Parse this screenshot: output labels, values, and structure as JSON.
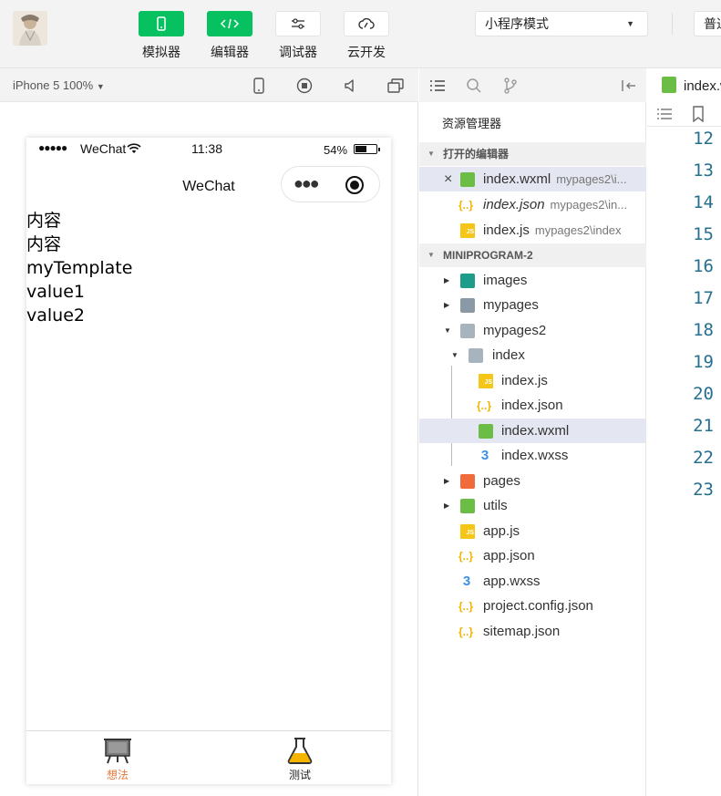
{
  "toolbar": {
    "buttons": [
      {
        "label": "模拟器",
        "icon": "phone-icon",
        "active": true
      },
      {
        "label": "编辑器",
        "icon": "code-icon",
        "active": true
      },
      {
        "label": "调试器",
        "icon": "debug-icon",
        "active": false
      },
      {
        "label": "云开发",
        "icon": "cloud-icon",
        "active": false
      }
    ],
    "mode_select": "小程序模式",
    "compile_select": "普通编译"
  },
  "simulator": {
    "device": "iPhone 5 100%",
    "status": {
      "carrier": "WeChat",
      "time": "11:38",
      "battery": "54%",
      "battery_level": 0.54
    },
    "nav_title": "WeChat",
    "content_lines": [
      "内容",
      "内容",
      "myTemplate",
      "value1",
      "value2"
    ],
    "tabs": [
      {
        "label": "想法",
        "icon": "easel-icon",
        "active": true,
        "color": "#e8793e"
      },
      {
        "label": "测试",
        "icon": "flask-icon",
        "active": false,
        "color": "#222222"
      }
    ]
  },
  "explorer": {
    "title": "资源管理器",
    "open_editors_title": "打开的编辑器",
    "open_editors": [
      {
        "name": "index.wxml",
        "path": "mypages2\\i...",
        "type": "wxml"
      },
      {
        "name": "index.json",
        "path": "mypages2\\in...",
        "type": "json"
      },
      {
        "name": "index.js",
        "path": "mypages2\\index",
        "type": "js"
      }
    ],
    "project_title": "MINIPROGRAM-2",
    "tree": [
      {
        "name": "images",
        "type": "folder",
        "color": "#1e9c8a"
      },
      {
        "name": "mypages",
        "type": "folder",
        "color": "#8a99a6"
      },
      {
        "name": "mypages2",
        "type": "folder-open",
        "color": "#8a99a6"
      },
      {
        "name": "index",
        "type": "folder-open",
        "color": "#8a99a6"
      },
      {
        "name": "index.js",
        "type": "js"
      },
      {
        "name": "index.json",
        "type": "json"
      },
      {
        "name": "index.wxml",
        "type": "wxml"
      },
      {
        "name": "index.wxss",
        "type": "wxss"
      },
      {
        "name": "pages",
        "type": "folder",
        "color": "#f06a3b"
      },
      {
        "name": "utils",
        "type": "folder",
        "color": "#6cbd45"
      },
      {
        "name": "app.js",
        "type": "js"
      },
      {
        "name": "app.json",
        "type": "json"
      },
      {
        "name": "app.wxss",
        "type": "wxss"
      },
      {
        "name": "project.config.json",
        "type": "json"
      },
      {
        "name": "sitemap.json",
        "type": "json"
      }
    ]
  },
  "editor": {
    "tab_name": "index.wxml",
    "line_numbers": [
      "12",
      "13",
      "14",
      "15",
      "16",
      "17",
      "18",
      "19",
      "20",
      "21",
      "22",
      "23"
    ]
  }
}
